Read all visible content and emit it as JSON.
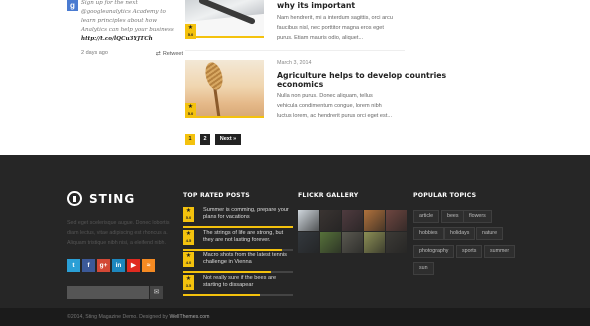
{
  "tweet": {
    "icon": "google-plus-icon",
    "lines": [
      "Sign up for the next",
      "@googleanalytics Academy to",
      "learn principles about how",
      "Analytics can help your business"
    ],
    "link": "http://t.co/lQCu3YJTCh",
    "time": "2 days ago",
    "retweet_label": "Retweet"
  },
  "posts": [
    {
      "title": "why its important",
      "excerpt": [
        "Nam hendrerit, mi a interdum sagittis, orci arcu",
        "faucibus nisl, nec porttitor magna eros eget",
        "purus. Etiam mauris odio, aliquet..."
      ],
      "rating": "5.0"
    },
    {
      "date": "March 3, 2014",
      "title_lines": [
        "Agriculture helps to develop countries",
        "economics"
      ],
      "excerpt": [
        "Nulla non purus. Donec aliquam, tellus",
        "vehicula condimentum congue, lorem nibh",
        "luctus lorem, ac hendrerit purus orci eget est..."
      ],
      "rating": "5.0"
    }
  ],
  "pagination": {
    "pages": [
      "1",
      "2"
    ],
    "next": "Next »"
  },
  "footer": {
    "logo_text": "STING",
    "about": "Sed eget scelerisque augue. Donec lobortis diam lectus, vitae adipiscing est rhoncus a. Aliquam tristique nibh nisi, a eleifend nibh.",
    "social": [
      {
        "name": "twitter-icon",
        "glyph": "t",
        "color": "#2a9fd6"
      },
      {
        "name": "facebook-icon",
        "glyph": "f",
        "color": "#3b5998"
      },
      {
        "name": "google-plus-icon",
        "glyph": "g+",
        "color": "#d34836"
      },
      {
        "name": "linkedin-icon",
        "glyph": "in",
        "color": "#1d87be"
      },
      {
        "name": "youtube-icon",
        "glyph": "▶",
        "color": "#e02a20"
      },
      {
        "name": "rss-icon",
        "glyph": "≈",
        "color": "#f58a22"
      }
    ],
    "subscribe_placeholder": "",
    "top_rated": {
      "heading": "TOP RATED POSTS",
      "items": [
        {
          "title": "Summer is comming, prepare your plans for vacations",
          "rating": "5.0",
          "fill": 1.0
        },
        {
          "title": "The strings of life are strong, but they are not lasting forever.",
          "rating": "4.5",
          "fill": 0.9
        },
        {
          "title": "Macro shots from the latest tennis challenge in Vienna",
          "rating": "4.0",
          "fill": 0.8
        },
        {
          "title": "Not really sure if the bees are starting to dissapear",
          "rating": "3.5",
          "fill": 0.7
        }
      ]
    },
    "flickr": {
      "heading": "FLICKR GALLERY",
      "photo_colors": [
        "#cfd6dc",
        "#3a3432",
        "#4f3b3f",
        "#b0713c",
        "#6e4640",
        "#33383d",
        "#56713a",
        "#5a5950",
        "#8c8f55",
        "#3c3a36"
      ]
    },
    "topics": {
      "heading": "POPULAR TOPICS",
      "tags": [
        "article",
        "bees",
        "flowers",
        "hobbies",
        "holidays",
        "nature",
        "photography",
        "sports",
        "summer",
        "sun"
      ]
    },
    "copyright_prefix": "©2014, Sting Magazine Demo. Designed by ",
    "copyright_brand": "WellThemes.com"
  },
  "colors": {
    "accent": "#f4c20d",
    "footer_bg": "#262626"
  }
}
